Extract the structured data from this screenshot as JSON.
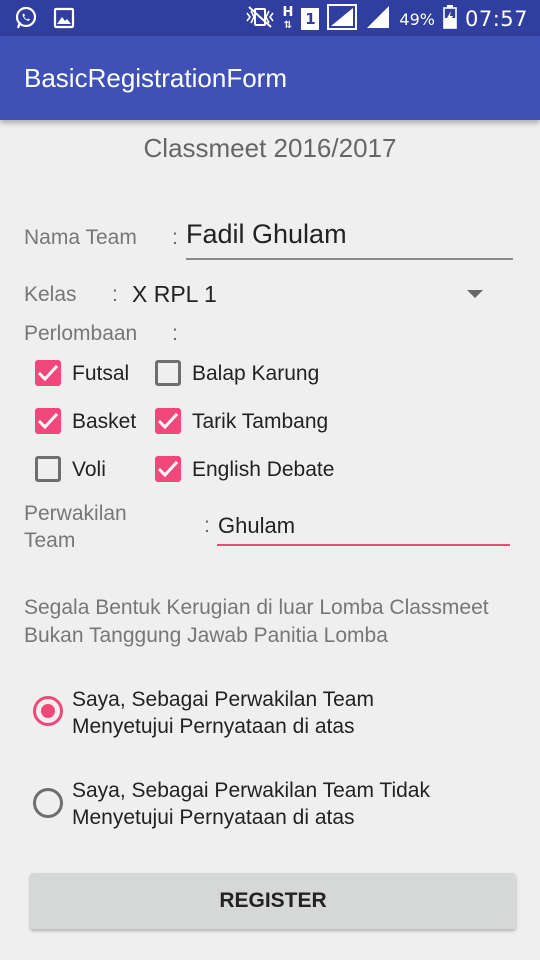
{
  "status_bar": {
    "battery": "49%",
    "time": "07:57",
    "network_letter": "H",
    "sim_slot": "1"
  },
  "app": {
    "title": "BasicRegistrationForm"
  },
  "form": {
    "heading": "Classmeet 2016/2017",
    "team_name": {
      "label": "Nama Team",
      "colon": ":",
      "value": "Fadil Ghulam"
    },
    "class": {
      "label": "Kelas",
      "colon": ":",
      "value": "X RPL 1"
    },
    "competitions": {
      "label": "Perlombaan",
      "colon": ":",
      "items": [
        {
          "label": "Futsal",
          "checked": true
        },
        {
          "label": "Balap Karung",
          "checked": false
        },
        {
          "label": "Basket",
          "checked": true
        },
        {
          "label": "Tarik Tambang",
          "checked": true
        },
        {
          "label": "Voli",
          "checked": false
        },
        {
          "label": "English Debate",
          "checked": true
        }
      ]
    },
    "representative": {
      "label_line1": "Perwakilan",
      "label_line2": "Team",
      "colon": ":",
      "value": "Ghulam"
    },
    "disclaimer": {
      "line1": "Segala Bentuk Kerugian di luar Lomba Classmeet",
      "line2": "Bukan Tanggung Jawab Panitia Lomba"
    },
    "agreement": [
      {
        "line1": "Saya, Sebagai Perwakilan Team",
        "line2": "Menyetujui Pernyataan di atas",
        "selected": true
      },
      {
        "line1": "Saya, Sebagai Perwakilan Team Tidak",
        "line2": "Menyetujui Pernyataan di atas",
        "selected": false
      }
    ],
    "register_label": "REGISTER"
  },
  "colors": {
    "status_bar": "#303f9f",
    "app_bar": "#3f51b5",
    "accent": "#ef4879"
  }
}
